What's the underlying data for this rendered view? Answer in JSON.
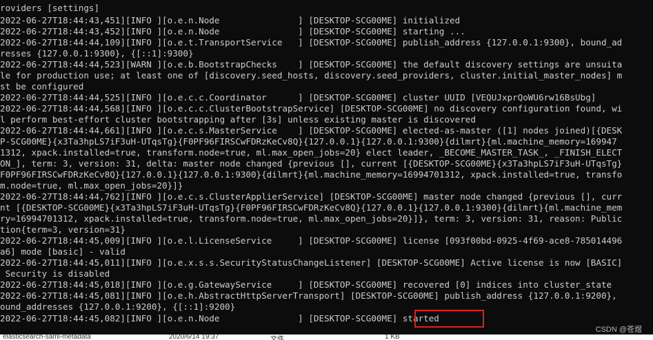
{
  "console": {
    "lines": [
      "roviders [settings]",
      "2022-06-27T18:44:43,451][INFO ][o.e.n.Node               ] [DESKTOP-SCG00ME] initialized",
      "2022-06-27T18:44:43,452][INFO ][o.e.n.Node               ] [DESKTOP-SCG00ME] starting ...",
      "2022-06-27T18:44:44,109][INFO ][o.e.t.TransportService   ] [DESKTOP-SCG00ME] publish_address {127.0.0.1:9300}, bound_ad",
      "resses {127.0.0.1:9300}, {[::1]:9300}",
      "2022-06-27T18:44:44,523][WARN ][o.e.b.BootstrapChecks    ] [DESKTOP-SCG00ME] the default discovery settings are unsuita",
      "le for production use; at least one of [discovery.seed_hosts, discovery.seed_providers, cluster.initial_master_nodes] m",
      "st be configured",
      "2022-06-27T18:44:44,525][INFO ][o.e.c.c.Coordinator      ] [DESKTOP-SCG00ME] cluster UUID [VEQUJxprQoWU6rw16BsUbg]",
      "2022-06-27T18:44:44,568][INFO ][o.e.c.c.ClusterBootstrapService] [DESKTOP-SCG00ME] no discovery configuration found, wi",
      "l perform best-effort cluster bootstrapping after [3s] unless existing master is discovered",
      "2022-06-27T18:44:44,661][INFO ][o.e.c.s.MasterService    ] [DESKTOP-SCG00ME] elected-as-master ([1] nodes joined)[{DESK",
      "P-SCG00ME}{x3Ta3hpLS7iF3uH-UTqsTg}{F0PF96FIRSCwFDRzKeCv8Q}{127.0.0.1}{127.0.0.1:9300}{dilmrt}{ml.machine_memory=169947",
      "1312, xpack.installed=true, transform.node=true, ml.max_open_jobs=20} elect leader, _BECOME_MASTER_TASK_, _FINISH_ELECT",
      "ON_], term: 3, version: 31, delta: master node changed {previous [], current [{DESKTOP-SCG00ME}{x3Ta3hpLS7iF3uH-UTqsTg}",
      "F0PF96FIRSCwFDRzKeCv8Q}{127.0.0.1}{127.0.0.1:9300}{dilmrt}{ml.machine_memory=16994701312, xpack.installed=true, transfo",
      "m.node=true, ml.max_open_jobs=20}]}",
      "2022-06-27T18:44:44,762][INFO ][o.e.c.s.ClusterApplierService] [DESKTOP-SCG00ME] master node changed {previous [], curr",
      "nt [{DESKTOP-SCG00ME}{x3Ta3hpLS7iF3uH-UTqsTg}{F0PF96FIRSCwFDRzKeCv8Q}{127.0.0.1}{127.0.0.1:9300}{dilmrt}{ml.machine_mem",
      "ry=16994701312, xpack.installed=true, transform.node=true, ml.max_open_jobs=20}]}, term: 3, version: 31, reason: Public",
      "tion{term=3, version=31}",
      "2022-06-27T18:44:45,009][INFO ][o.e.l.LicenseService     ] [DESKTOP-SCG00ME] license [093f00bd-0925-4f69-ace8-785014496",
      "a6] mode [basic] - valid",
      "2022-06-27T18:44:45,011][INFO ][o.e.x.s.s.SecurityStatusChangeListener] [DESKTOP-SCG00ME] Active license is now [BASIC]",
      " Security is disabled",
      "2022-06-27T18:44:45,018][INFO ][o.e.g.GatewayService     ] [DESKTOP-SCG00ME] recovered [0] indices into cluster_state",
      "2022-06-27T18:44:45,081][INFO ][o.e.h.AbstractHttpServerTransport] [DESKTOP-SCG00ME] publish_address {127.0.0.1:9200},",
      "ound_addresses {127.0.0.1:9200}, {[::1]:9200}",
      "2022-06-27T18:44:45,082][INFO ][o.e.n.Node               ] [DESKTOP-SCG00ME] started"
    ]
  },
  "watermark": "CSDN @苍煜",
  "explorer_row": {
    "name": "elasticsearch-saml-metadata",
    "date": "2020/6/14 19:37",
    "type": "文件",
    "size": "1 KB"
  },
  "colors": {
    "console_background": "#0c0c0c",
    "console_text": "#cccccc",
    "highlight_border": "#e02020"
  }
}
